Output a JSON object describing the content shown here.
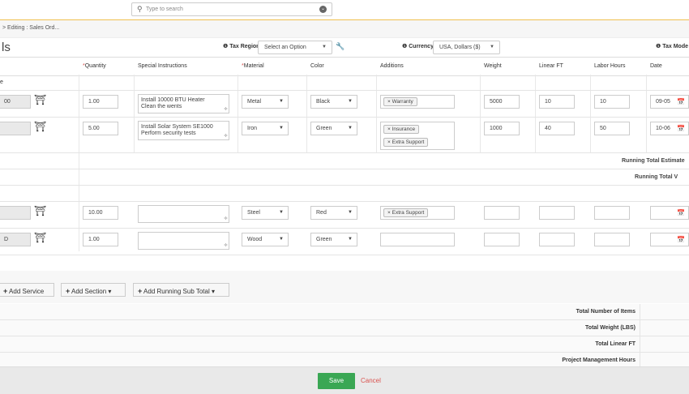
{
  "search": {
    "placeholder": "Type to search"
  },
  "breadcrumb": "> Editing : Sales Ord...",
  "page_title": "ls",
  "tax_region": {
    "label": "Tax Region",
    "value": "Select an Option"
  },
  "currency": {
    "label": "Currency",
    "value": "USA, Dollars ($)"
  },
  "tax_mode": {
    "label": "Tax Mode"
  },
  "columns": [
    "Quantity",
    "Special Instructions",
    "Material",
    "Color",
    "Additions",
    "Weight",
    "Linear FT",
    "Labor Hours",
    "Date"
  ],
  "section_label": "e",
  "rows": [
    {
      "id": "00",
      "qty": "1.00",
      "instr1": "Install 10000 BTU Heater",
      "instr2": "Clean the wents",
      "material": "Metal",
      "color": "Black",
      "additions": [
        "Warranty"
      ],
      "weight": "5000",
      "linear": "10",
      "labor": "10",
      "date": "09-05"
    },
    {
      "id": "",
      "qty": "5.00",
      "instr1": "Install Solar System SE1000",
      "instr2": "Perform security tests",
      "material": "Iron",
      "color": "Green",
      "additions": [
        "Insurance",
        "Extra Support"
      ],
      "weight": "1000",
      "linear": "40",
      "labor": "50",
      "date": "10-06"
    },
    {
      "id": "",
      "qty": "10.00",
      "instr1": "",
      "instr2": "",
      "material": "Steel",
      "color": "Red",
      "additions": [
        "Extra Support"
      ],
      "weight": "",
      "linear": "",
      "labor": "",
      "date": ""
    },
    {
      "id": "D",
      "qty": "1.00",
      "instr1": "",
      "instr2": "",
      "material": "Wood",
      "color": "Green",
      "additions": [],
      "weight": "",
      "linear": "",
      "labor": "",
      "date": ""
    }
  ],
  "running_total_estimate": "Running Total Estimate",
  "running_total": "Running Total V",
  "buttons": {
    "add_service": "Add Service",
    "add_section": "Add Section",
    "add_running": "Add Running Sub Total"
  },
  "summary": [
    "Total Number of Items",
    "Total Weight (LBS)",
    "Total Linear FT",
    "Project Management Hours"
  ],
  "footer": {
    "save": "Save",
    "cancel": "Cancel"
  },
  "colors": {
    "save": "#3aa754",
    "cancel": "#d9534f",
    "required": "#d9534f",
    "accent_border": "#f0c050"
  }
}
